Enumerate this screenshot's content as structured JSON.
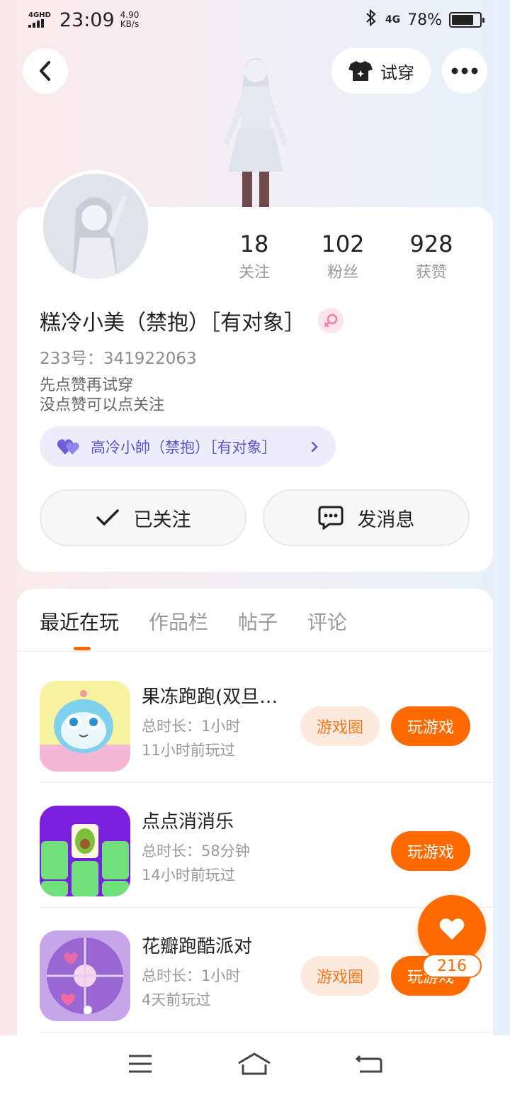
{
  "status_bar": {
    "network": "4GHD",
    "time": "23:09",
    "speed_value": "4.90",
    "speed_unit": "KB/s",
    "network_right": "4G",
    "battery_percent": "78%",
    "battery_level": 0.78
  },
  "header": {
    "tryon_label": "试穿"
  },
  "profile": {
    "stats": [
      {
        "value": "18",
        "label": "关注"
      },
      {
        "value": "102",
        "label": "粉丝"
      },
      {
        "value": "928",
        "label": "获赞"
      }
    ],
    "name": "糕冷小美（禁抱）［有对象］",
    "uid": "233号：341922063",
    "bio_line1": "先点赞再试穿",
    "bio_line2": "没点赞可以点关注",
    "partner": "高冷小帥（禁抱）［有对象］",
    "follow_label": "已关注",
    "message_label": "发消息"
  },
  "tabs": [
    "最近在玩",
    "作品栏",
    "帖子",
    "评论"
  ],
  "games": [
    {
      "title": "果冻跑跑(双旦…",
      "duration": "总时长：1小时",
      "last_played": "11小时前玩过",
      "circle_label": "游戏圈",
      "play_label": "玩游戏"
    },
    {
      "title": "点点消消乐",
      "duration": "总时长：58分钟",
      "last_played": "14小时前玩过",
      "play_label": "玩游戏"
    },
    {
      "title": "花瓣跑酷派对",
      "duration": "总时长：1小时",
      "last_played": "4天前玩过",
      "circle_label": "游戏圈",
      "play_label": "玩游戏"
    }
  ],
  "like_count": "216",
  "colors": {
    "accent": "#ff6a00",
    "partner_text": "#5b55c8",
    "partner_bg": "#ececfb"
  }
}
